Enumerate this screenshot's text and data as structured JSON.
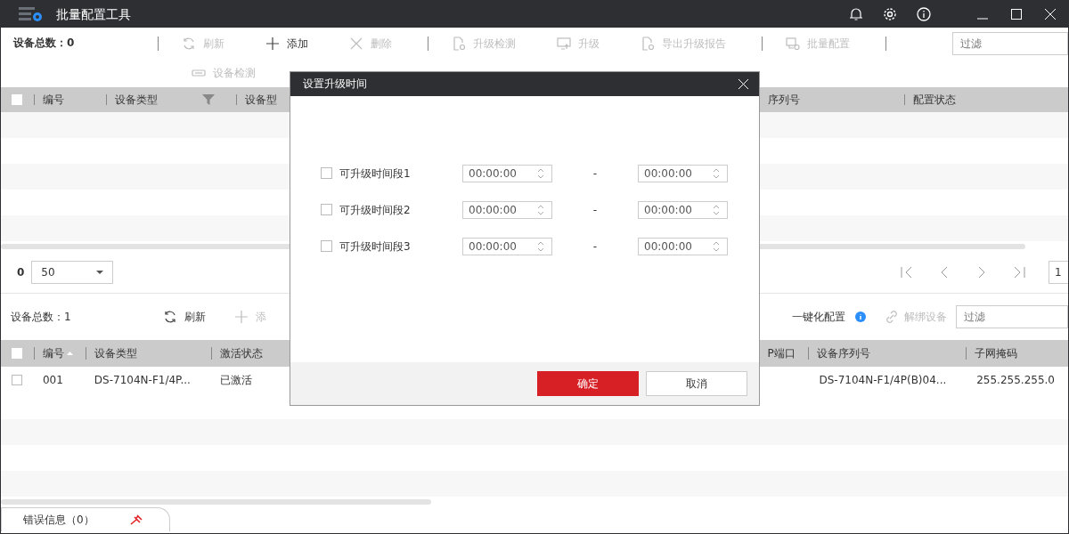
{
  "window": {
    "title": "批量配置工具"
  },
  "top_panel": {
    "device_count": "设备总数：0",
    "toolbar": [
      {
        "label": "刷新",
        "kind": "refresh",
        "disabled": true
      },
      {
        "label": "添加",
        "kind": "plus",
        "disabled": false
      },
      {
        "label": "删除",
        "kind": "cross",
        "disabled": true
      },
      {
        "label": "升级检测",
        "kind": "doc-gear",
        "disabled": true
      },
      {
        "label": "升级",
        "kind": "monitor",
        "disabled": true
      },
      {
        "label": "导出升级报告",
        "kind": "doc-gear",
        "disabled": true
      },
      {
        "label": "批量配置",
        "kind": "copy-gear",
        "disabled": true
      }
    ],
    "toolbar_row2": [
      {
        "label": "设备检测",
        "kind": "chip",
        "disabled": true
      }
    ],
    "filter": {
      "placeholder": "过滤"
    },
    "header_checked": false,
    "left_columns": [
      {
        "label": "编号",
        "filter": false
      },
      {
        "label": "设备类型",
        "filter": true
      },
      {
        "label": "设备型",
        "filter": false
      }
    ],
    "right_columns": [
      {
        "label": "序列号",
        "filter": false
      },
      {
        "label": "配置状态",
        "filter": false
      }
    ]
  },
  "pagination": {
    "total": "0",
    "page_size": "50",
    "page": "1"
  },
  "bottom_panel": {
    "device_count": "设备总数：1",
    "toolbar_left": [
      {
        "label": "刷新",
        "kind": "refresh",
        "disabled": false
      },
      {
        "label": "添",
        "kind": "plus",
        "disabled": true
      }
    ],
    "toolbar_right": [
      {
        "label": "一键化配置",
        "kind": "info",
        "disabled": false
      },
      {
        "label": "解绑设备",
        "kind": "link",
        "disabled": true
      }
    ],
    "filter": {
      "placeholder": "过滤"
    },
    "header_checked": false,
    "left_columns": [
      {
        "label": "编号",
        "sorted": true
      },
      {
        "label": "设备类型",
        "sorted": false
      },
      {
        "label": "激活状态",
        "sorted": false
      }
    ],
    "right_columns": [
      {
        "label": "P端口",
        "sorted": false
      },
      {
        "label": "设备序列号",
        "sorted": false
      },
      {
        "label": "子网掩码",
        "sorted": false
      }
    ],
    "rows": [
      {
        "checked": false,
        "left_cells": [
          "001",
          "DS-7104N-F1/4P...",
          "已激活"
        ],
        "right_cells": [
          "DS-7104N-F1/4P(B)04...",
          "255.255.255.0"
        ]
      }
    ]
  },
  "error_tab": {
    "label": "错误信息（0）"
  },
  "dialog": {
    "title": "设置升级时间",
    "periods": [
      {
        "label": "可升级时间段1",
        "checked": false,
        "start": "00:00:00",
        "separator": "-",
        "end": "00:00:00"
      },
      {
        "label": "可升级时间段2",
        "checked": false,
        "start": "00:00:00",
        "separator": "-",
        "end": "00:00:00"
      },
      {
        "label": "可升级时间段3",
        "checked": false,
        "start": "00:00:00",
        "separator": "-",
        "end": "00:00:00"
      }
    ],
    "buttons": [
      {
        "label": "确定",
        "primary": true
      },
      {
        "label": "取消",
        "primary": false
      }
    ]
  }
}
